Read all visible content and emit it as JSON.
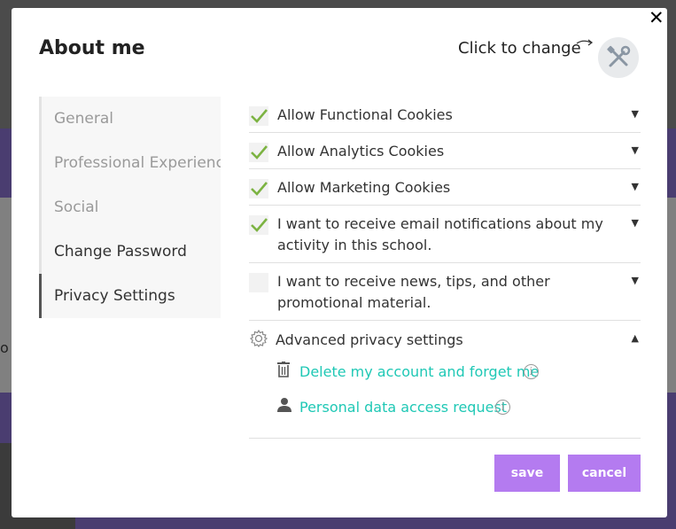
{
  "modal": {
    "title": "About me",
    "close_label": "✕",
    "click_to_change": "Click to change"
  },
  "sidebar": {
    "items": [
      {
        "label": "General",
        "active": false
      },
      {
        "label": "Professional Experience",
        "active": false
      },
      {
        "label": "Social",
        "active": false
      },
      {
        "label": "Change Password",
        "active": false
      },
      {
        "label": "Privacy Settings",
        "active": true
      }
    ]
  },
  "privacy": {
    "options": [
      {
        "label": "Allow Functional Cookies",
        "checked": true
      },
      {
        "label": "Allow Analytics Cookies",
        "checked": true
      },
      {
        "label": "Allow Marketing Cookies",
        "checked": true
      },
      {
        "label": "I want to receive email notifications about my activity in this school.",
        "checked": true
      },
      {
        "label": "I want to receive news, tips, and other promotional material.",
        "checked": false
      }
    ],
    "advanced": {
      "title": "Advanced privacy settings",
      "delete_link": "Delete my account and forget me",
      "data_request_link": "Personal data access request"
    }
  },
  "buttons": {
    "save": "save",
    "cancel": "cancel"
  },
  "colors": {
    "accent_button": "#b47bf0",
    "link": "#1fc8b5",
    "checkmark": "#7cb342"
  },
  "background_page": {
    "edge_text": "o"
  }
}
